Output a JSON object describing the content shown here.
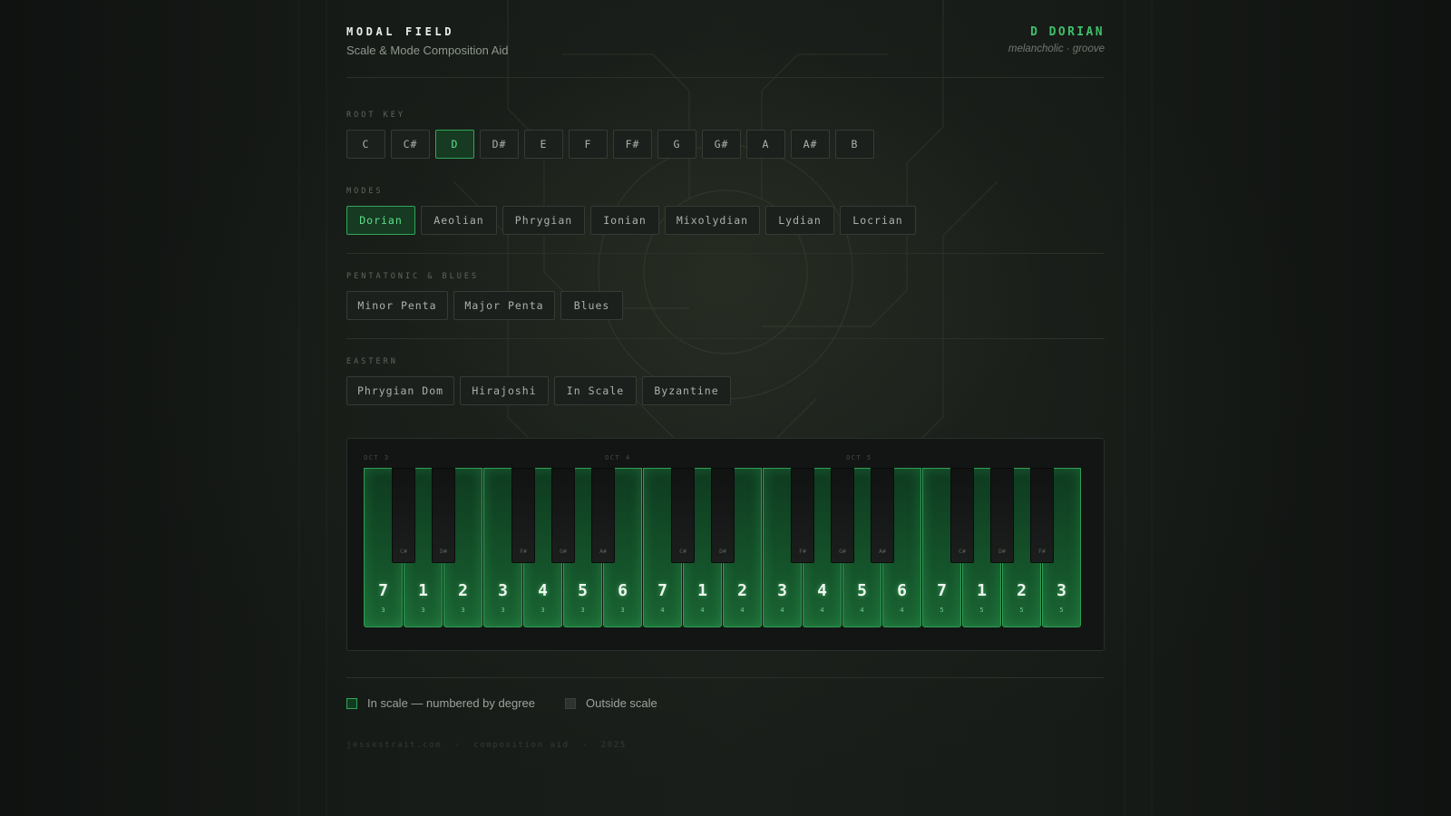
{
  "header": {
    "title": "MODAL FIELD",
    "subtitle": "Scale & Mode Composition Aid",
    "current_scale": "D DORIAN",
    "current_mood": "melancholic · groove"
  },
  "sections": {
    "root_key": "ROOT KEY",
    "modes": "MODES",
    "pentatonic": "PENTATONIC & BLUES",
    "eastern": "EASTERN"
  },
  "root_keys": [
    "C",
    "C#",
    "D",
    "D#",
    "E",
    "F",
    "F#",
    "G",
    "G#",
    "A",
    "A#",
    "B"
  ],
  "selected_root": "D",
  "modes": [
    "Dorian",
    "Aeolian",
    "Phrygian",
    "Ionian",
    "Mixolydian",
    "Lydian",
    "Locrian"
  ],
  "selected_mode": "Dorian",
  "pentatonic": [
    "Minor Penta",
    "Major Penta",
    "Blues"
  ],
  "eastern": [
    "Phrygian Dom",
    "Hirajoshi",
    "In Scale",
    "Byzantine"
  ],
  "piano": {
    "octave_labels": [
      "OCT 3",
      "OCT 4",
      "OCT 5"
    ],
    "white_keys": [
      {
        "degree": "7",
        "octave": "3"
      },
      {
        "degree": "1",
        "octave": "3"
      },
      {
        "degree": "2",
        "octave": "3"
      },
      {
        "degree": "3",
        "octave": "3"
      },
      {
        "degree": "4",
        "octave": "3"
      },
      {
        "degree": "5",
        "octave": "3"
      },
      {
        "degree": "6",
        "octave": "3"
      },
      {
        "degree": "7",
        "octave": "4"
      },
      {
        "degree": "1",
        "octave": "4"
      },
      {
        "degree": "2",
        "octave": "4"
      },
      {
        "degree": "3",
        "octave": "4"
      },
      {
        "degree": "4",
        "octave": "4"
      },
      {
        "degree": "5",
        "octave": "4"
      },
      {
        "degree": "6",
        "octave": "4"
      },
      {
        "degree": "7",
        "octave": "5"
      },
      {
        "degree": "1",
        "octave": "5"
      },
      {
        "degree": "2",
        "octave": "5"
      },
      {
        "degree": "3",
        "octave": "5"
      }
    ],
    "black_keys": [
      "C#",
      "D#",
      "F#",
      "G#",
      "A#",
      "C#",
      "D#",
      "F#",
      "G#",
      "A#",
      "C#",
      "D#",
      "F#"
    ]
  },
  "legend": {
    "in_scale": "In scale — numbered by degree",
    "outside": "Outside scale"
  },
  "footer": "jessestrait.com  ·  composition aid  ·  2025",
  "colors": {
    "accent": "#3fbf6a",
    "background": "#141714",
    "key_fill": "#145029"
  }
}
